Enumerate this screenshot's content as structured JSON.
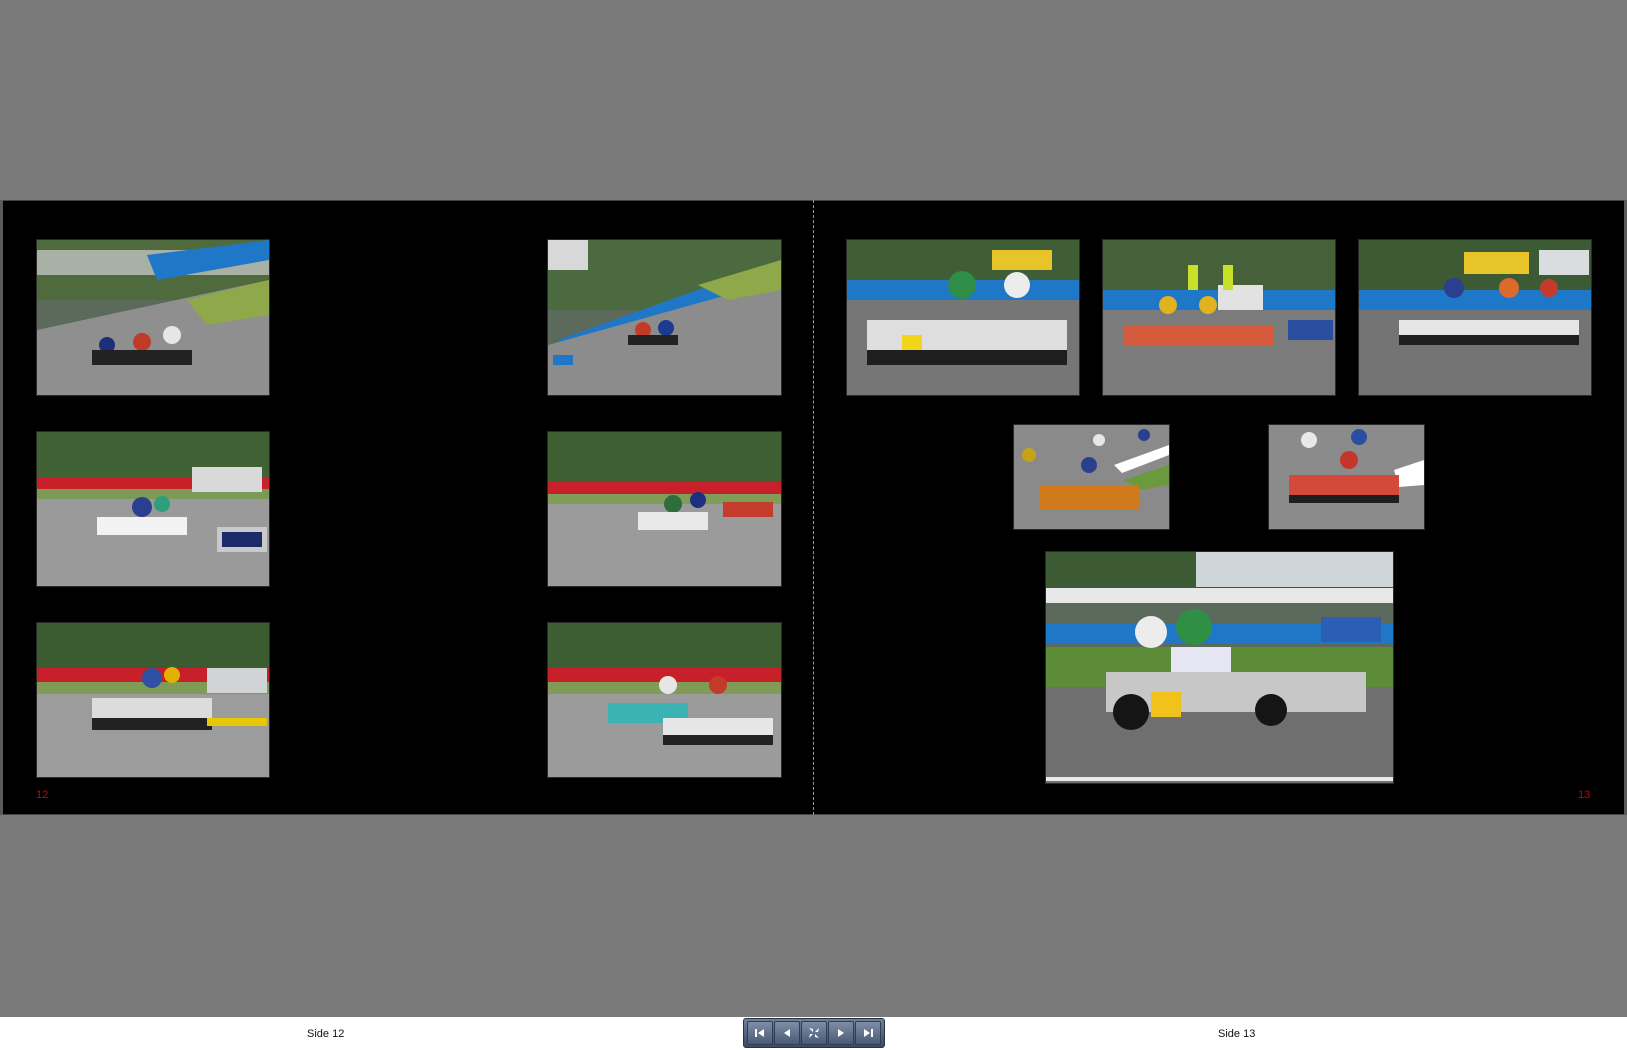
{
  "viewer": {
    "left_page_number": "12",
    "right_page_number": "13",
    "left_footer_label": "Side 12",
    "right_footer_label": "Side 13"
  },
  "photos": [
    {
      "name": "photo-karts-corner-group",
      "subject": "kart racing"
    },
    {
      "name": "photo-kart-track-overview",
      "subject": "kart racing"
    },
    {
      "name": "photo-karts-lecont-banner-1",
      "subject": "kart racing"
    },
    {
      "name": "photo-karts-lecont-banner-2",
      "subject": "kart racing"
    },
    {
      "name": "photo-kart-front-view",
      "subject": "kart racing"
    },
    {
      "name": "photo-karts-pack-straight",
      "subject": "kart racing"
    },
    {
      "name": "photo-kart-number-10",
      "subject": "kart racing"
    },
    {
      "name": "photo-karts-marshals",
      "subject": "kart racing"
    },
    {
      "name": "photo-karts-mjr-banner",
      "subject": "kart racing"
    },
    {
      "name": "photo-karts-curb-left",
      "subject": "kart racing"
    },
    {
      "name": "photo-karts-curb-right",
      "subject": "kart racing"
    },
    {
      "name": "photo-kart-number-43",
      "subject": "kart racing"
    }
  ],
  "navigation": {
    "buttons": [
      {
        "name": "first-page-button",
        "icon": "skip-first-icon"
      },
      {
        "name": "previous-page-button",
        "icon": "prev-icon"
      },
      {
        "name": "fullscreen-button",
        "icon": "fullscreen-collapse-icon"
      },
      {
        "name": "next-page-button",
        "icon": "next-icon"
      },
      {
        "name": "last-page-button",
        "icon": "skip-last-icon"
      }
    ]
  }
}
